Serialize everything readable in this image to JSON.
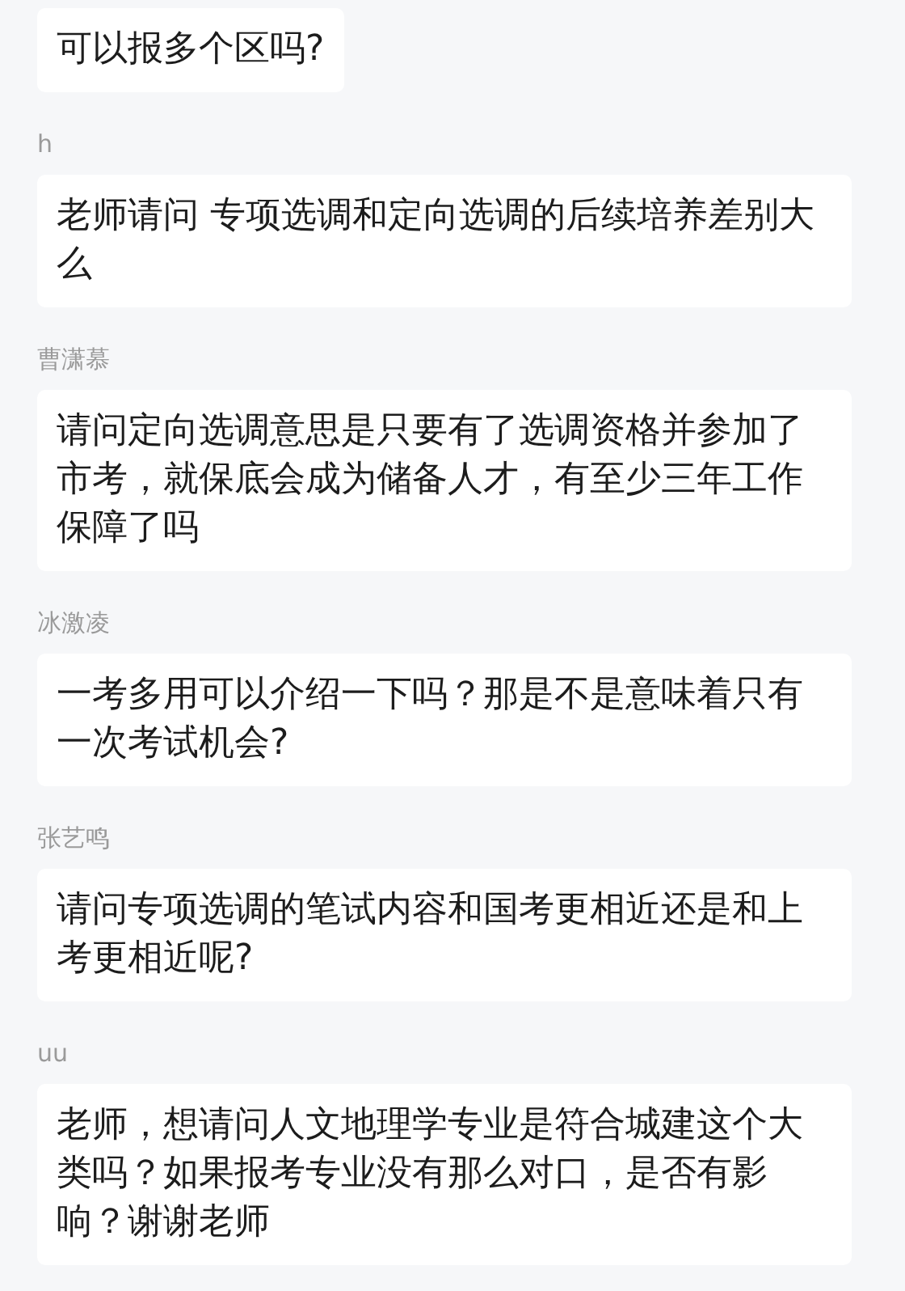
{
  "messages": [
    {
      "text": "可以报多个区吗?"
    },
    {
      "author": "h",
      "text": "老师请问 专项选调和定向选调的后续培养差别大么"
    },
    {
      "author": "曹潇慕",
      "text": "请问定向选调意思是只要有了选调资格并参加了市考，就保底会成为储备人才，有至少三年工作保障了吗"
    },
    {
      "author": "冰激凌",
      "text": "一考多用可以介绍一下吗？那是不是意味着只有一次考试机会?"
    },
    {
      "author": "张艺鸣",
      "text": "请问专项选调的笔试内容和国考更相近还是和上考更相近呢?"
    },
    {
      "author": "uu",
      "text": "老师，想请问人文地理学专业是符合城建这个大类吗？如果报考专业没有那么对口，是否有影响？谢谢老师"
    }
  ]
}
